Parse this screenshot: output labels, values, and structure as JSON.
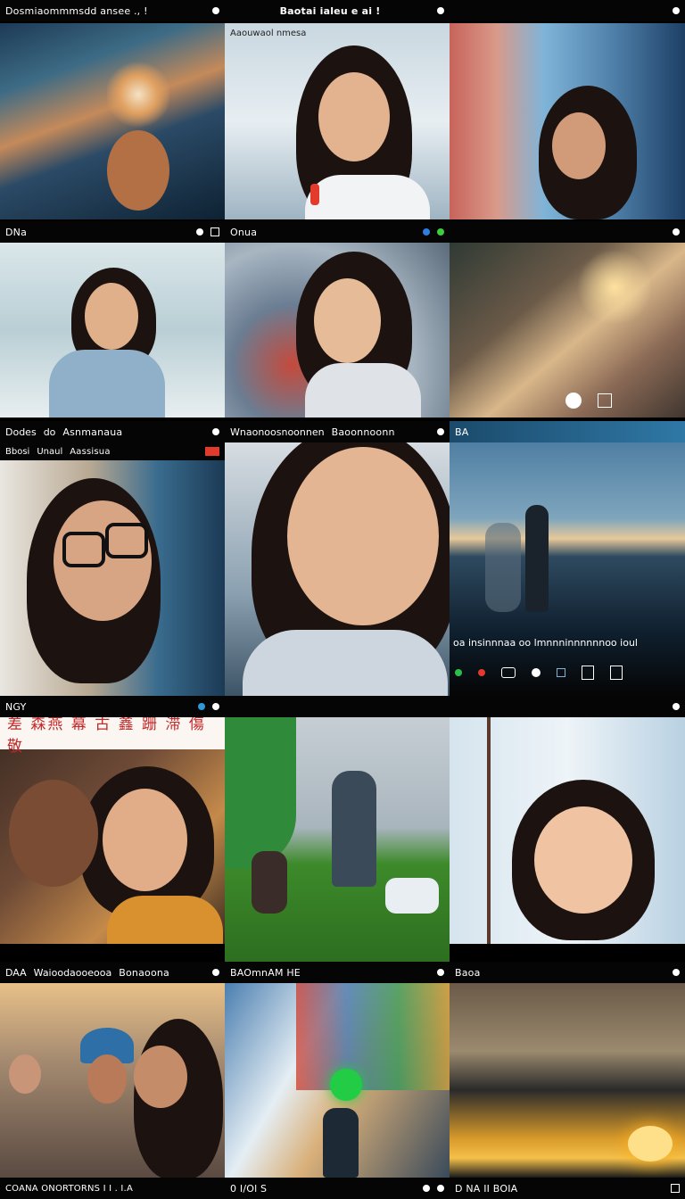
{
  "row1": {
    "bar_left": "Dosmiaommmsdd ansee ., !",
    "bar_mid": "Baotai ialeu e ai !",
    "tile2_caption_a": "Aaouwaol",
    "tile2_caption_b": "nmesa"
  },
  "row2": {
    "bar_left": "DNa",
    "bar_mid": "Onua"
  },
  "row3": {
    "bar_left": "Dodes",
    "bar_left_b": "do",
    "bar_left_c": "Asnmanaua",
    "bar_mid": "Wnaonoosnoonnen",
    "bar_mid_b": "Baoonnoonn",
    "bar_right": "BA",
    "sub_left": "Bbosi",
    "sub_left_b": "Unaul",
    "sub_left_c": "Aassisua",
    "tile9_caption": "oa insinnnaa  oo lmnnninnnnnnoo ioul"
  },
  "row4": {
    "bar_left": "NGY",
    "banner": "差 森燕 幕 古 鑫 跚 滞 傷 敬"
  },
  "row5": {
    "bar_left": "DAA",
    "bar_left_b": "Waioodaooeooa",
    "bar_left_c": "Bonaoona",
    "bar_mid": "BAOmnAM HE",
    "bar_right": "Baoa"
  },
  "row6": {
    "bar_left": "COANA ONORTORNS I I . I.A",
    "bar_mid": "0 I/Ol S",
    "bar_right": "D NA  II BOIA"
  },
  "colors": {
    "bar_bg": "#050505",
    "accent_red": "#c02a2a",
    "grass": "#3d8a2a"
  }
}
